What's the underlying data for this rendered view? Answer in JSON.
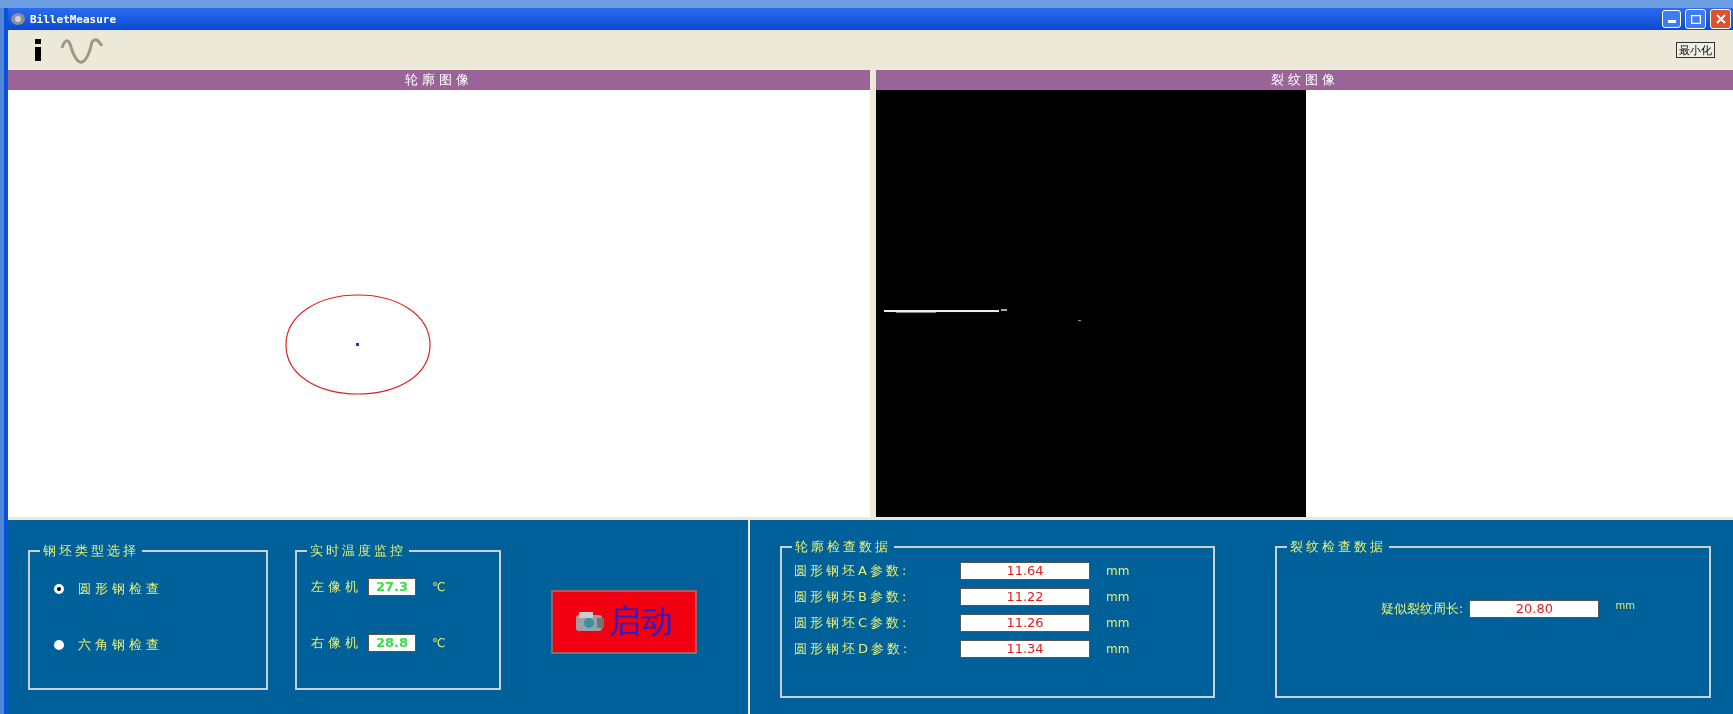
{
  "window": {
    "title": "BilletMeasure"
  },
  "toolbar": {
    "minimize_label": "最小化"
  },
  "panels": [
    {
      "title": "轮廓图像",
      "kind": "contour"
    },
    {
      "title": "裂纹图像",
      "kind": "crack"
    }
  ],
  "billet_type": {
    "title": "钢坯类型选择",
    "options": [
      {
        "label": "圆形钢检查",
        "selected": true
      },
      {
        "label": "六角钢检查",
        "selected": false
      }
    ]
  },
  "temperature": {
    "title": "实时温度监控",
    "cameras": [
      {
        "label": "左像机",
        "value": "27.3",
        "unit": "℃"
      },
      {
        "label": "右像机",
        "value": "28.8",
        "unit": "℃"
      }
    ]
  },
  "start_button": {
    "label": "启动"
  },
  "contour_data": {
    "title": "轮廓检查数据",
    "rows": [
      {
        "label": "圆形钢坯A参数:",
        "value": "11.64",
        "unit": "mm"
      },
      {
        "label": "圆形钢坯B参数:",
        "value": "11.22",
        "unit": "mm"
      },
      {
        "label": "圆形钢坯C参数:",
        "value": "11.26",
        "unit": "mm"
      },
      {
        "label": "圆形钢坯D参数:",
        "value": "11.34",
        "unit": "mm"
      }
    ]
  },
  "crack_data": {
    "title": "裂纹检查数据",
    "label": "疑似裂纹周长:",
    "value": "20.80",
    "unit": "mm"
  }
}
